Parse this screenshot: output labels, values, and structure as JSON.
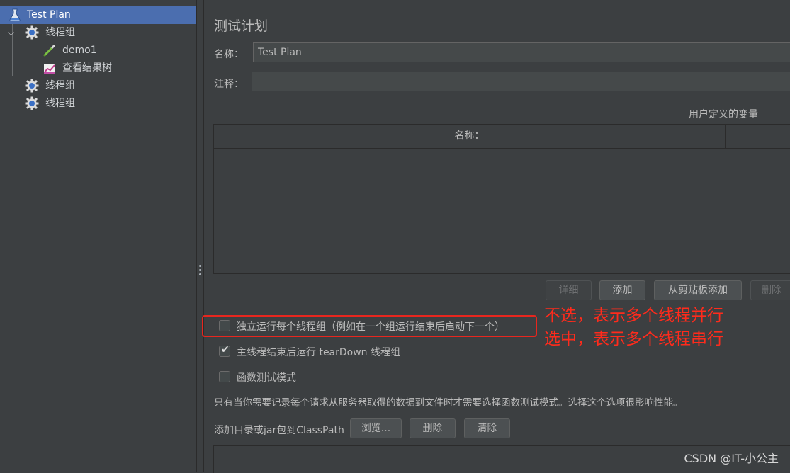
{
  "tree": {
    "items": [
      {
        "label": "Test Plan",
        "icon": "test-plan-icon"
      },
      {
        "label": "线程组",
        "icon": "gear-icon"
      },
      {
        "label": "demo1",
        "icon": "pipette-icon"
      },
      {
        "label": "查看结果树",
        "icon": "chart-icon"
      },
      {
        "label": "线程组",
        "icon": "gear-icon"
      },
      {
        "label": "线程组",
        "icon": "gear-icon"
      }
    ]
  },
  "panel": {
    "title": "测试计划",
    "name_label": "名称：",
    "name_value": "Test Plan",
    "comment_label": "注释：",
    "comment_value": "",
    "uservars_label": "用户定义的变量",
    "table": {
      "columns": [
        "名称："
      ]
    },
    "buttons": {
      "detail": "详细",
      "add": "添加",
      "add_clipboard": "从剪贴板添加",
      "delete": "删除"
    },
    "options": {
      "serialize": {
        "label": "独立运行每个线程组（例如在一个组运行结束后启动下一个）",
        "checked": false
      },
      "teardown": {
        "label": "主线程结束后运行 tearDown 线程组",
        "checked": true
      },
      "functional": {
        "label": "函数测试模式",
        "checked": false
      }
    },
    "functional_note": "只有当你需要记录每个请求从服务器取得的数据到文件时才需要选择函数测试模式。选择这个选项很影响性能。",
    "classpath_label": "添加目录或jar包到ClassPath",
    "classpath_buttons": {
      "browse": "浏览...",
      "delete": "删除",
      "clear": "清除"
    }
  },
  "annotation": {
    "line1": "不选，表示多个线程并行",
    "line2": "选中，表示多个线程串行",
    "color": "#ff2b1c"
  },
  "watermark": "CSDN @IT-小公主",
  "colors": {
    "background": "#3c3f41",
    "selection": "#4b6eaf",
    "annotation_red": "#e8261e"
  }
}
